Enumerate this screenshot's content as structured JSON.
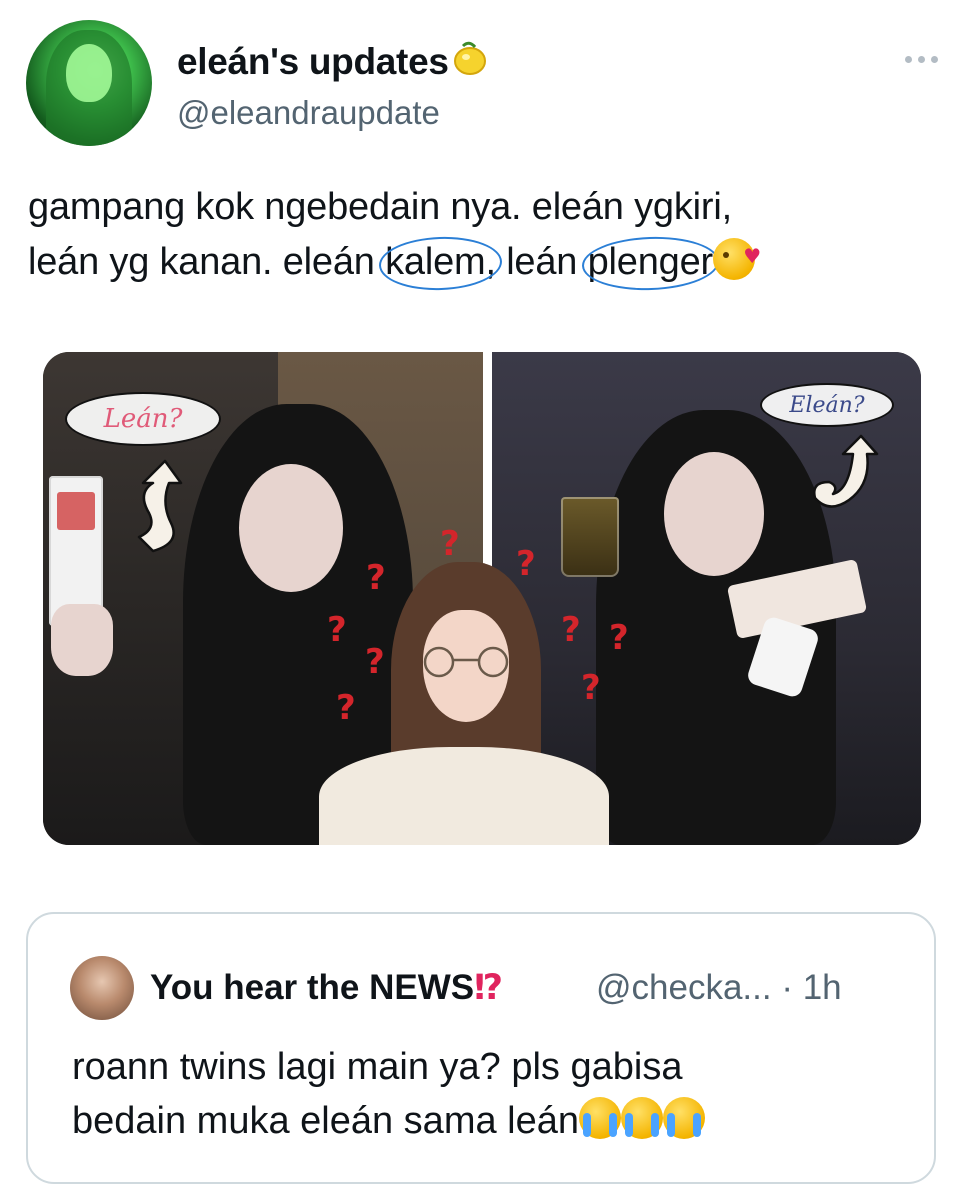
{
  "header": {
    "display_name": "eleán's updates",
    "handle": "@eleandraupdate"
  },
  "tweet": {
    "line1": "gampang kok ngebedain nya. eleán ygkiri,",
    "line2_part1": "leán yg kanan. eleán",
    "line2_word1": "kalem,",
    "line2_part2": "leán",
    "line2_word2": "plenger"
  },
  "media": {
    "label_left": "Leán?",
    "label_right": "Eleán?",
    "question_mark": "?"
  },
  "quoted_tweet": {
    "display_name": "You hear the NEWS",
    "name_mark": "⁉",
    "handle_time": "@checka... · 1h",
    "line1": "roann twins lagi main ya? pls gabisa",
    "line2": "bedain muka eleán sama leán"
  },
  "icons": {
    "more": "more-horizontal-icon",
    "header_emoji": "lemon-emoji",
    "tweet_emoji": "kissing-heart-emoji",
    "quote_emoji": "loudly-crying-emoji"
  },
  "colors": {
    "text": "#0f1419",
    "muted": "#536471",
    "border": "#cfd9de",
    "circle_annotation": "#2b7fd6",
    "question_marks": "#d4252b"
  }
}
